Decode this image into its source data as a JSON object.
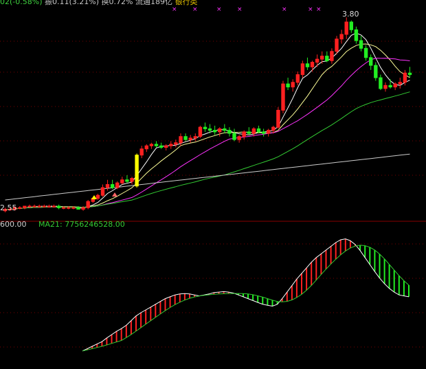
{
  "header": {
    "code_tail": "02(-0.58%)",
    "amplitude": "振0.11(3.21%)",
    "turnover": "换0.72%",
    "float_cap": "流通189亿",
    "sector": "银行类"
  },
  "indicator": {
    "value0": "600.00",
    "ma_label": "MA21: 7756246528.00"
  },
  "price_labels": {
    "high": "3.80",
    "low": "2.55"
  },
  "colors": {
    "up": "#ff2020",
    "down": "#22ee22",
    "highlight": "#ffff00",
    "ma_white": "#ffffff",
    "ma_yellow": "#ffff99",
    "ma_magenta": "#ff33ff",
    "ma_green": "#33cc33",
    "ma_gray": "#cccccc",
    "marker": "#ff33ff",
    "grid": "#7a0000"
  },
  "chart_data": {
    "type": "candlestick",
    "ohlc": [
      [
        2.55,
        2.57,
        2.54,
        2.56
      ],
      [
        2.56,
        2.57,
        2.55,
        2.56
      ],
      [
        2.56,
        2.58,
        2.55,
        2.57
      ],
      [
        2.57,
        2.58,
        2.56,
        2.57
      ],
      [
        2.57,
        2.58,
        2.56,
        2.58
      ],
      [
        2.58,
        2.59,
        2.57,
        2.58
      ],
      [
        2.58,
        2.59,
        2.57,
        2.58
      ],
      [
        2.58,
        2.59,
        2.57,
        2.58
      ],
      [
        2.58,
        2.59,
        2.57,
        2.58
      ],
      [
        2.58,
        2.59,
        2.57,
        2.58
      ],
      [
        2.58,
        2.59,
        2.57,
        2.58
      ],
      [
        2.58,
        2.59,
        2.56,
        2.57
      ],
      [
        2.57,
        2.58,
        2.56,
        2.57
      ],
      [
        2.57,
        2.58,
        2.56,
        2.57
      ],
      [
        2.57,
        2.58,
        2.56,
        2.57
      ],
      [
        2.57,
        2.58,
        2.56,
        2.56
      ],
      [
        2.56,
        2.58,
        2.55,
        2.57
      ],
      [
        2.57,
        2.62,
        2.56,
        2.61
      ],
      [
        2.61,
        2.64,
        2.6,
        2.63
      ],
      [
        2.63,
        2.66,
        2.62,
        2.65
      ],
      [
        2.65,
        2.72,
        2.64,
        2.7
      ],
      [
        2.7,
        2.75,
        2.68,
        2.72
      ],
      [
        2.72,
        2.75,
        2.69,
        2.7
      ],
      [
        2.7,
        2.74,
        2.69,
        2.73
      ],
      [
        2.73,
        2.77,
        2.72,
        2.75
      ],
      [
        2.75,
        2.78,
        2.73,
        2.74
      ],
      [
        2.74,
        2.77,
        2.72,
        2.76
      ],
      [
        2.71,
        2.92,
        2.7,
        2.91
      ],
      [
        2.91,
        2.97,
        2.89,
        2.95
      ],
      [
        2.95,
        2.98,
        2.93,
        2.97
      ],
      [
        2.97,
        2.99,
        2.95,
        2.98
      ],
      [
        2.98,
        3.0,
        2.96,
        2.97
      ],
      [
        2.97,
        2.99,
        2.95,
        2.96
      ],
      [
        2.96,
        2.98,
        2.94,
        2.97
      ],
      [
        2.97,
        3.0,
        2.95,
        2.98
      ],
      [
        2.98,
        3.01,
        2.96,
        2.99
      ],
      [
        2.99,
        3.05,
        2.97,
        3.03
      ],
      [
        3.03,
        3.05,
        3.0,
        3.01
      ],
      [
        3.01,
        3.04,
        2.99,
        3.02
      ],
      [
        3.02,
        3.05,
        3.0,
        3.03
      ],
      [
        3.03,
        3.1,
        3.02,
        3.09
      ],
      [
        3.09,
        3.12,
        3.06,
        3.08
      ],
      [
        3.08,
        3.11,
        3.05,
        3.07
      ],
      [
        3.07,
        3.1,
        3.04,
        3.06
      ],
      [
        3.06,
        3.09,
        3.03,
        3.08
      ],
      [
        3.08,
        3.11,
        3.05,
        3.07
      ],
      [
        3.07,
        3.09,
        3.03,
        3.05
      ],
      [
        3.05,
        3.08,
        3.0,
        3.01
      ],
      [
        3.01,
        3.04,
        2.99,
        3.03
      ],
      [
        3.03,
        3.07,
        3.01,
        3.06
      ],
      [
        3.06,
        3.09,
        3.04,
        3.05
      ],
      [
        3.05,
        3.09,
        3.03,
        3.08
      ],
      [
        3.08,
        3.1,
        3.05,
        3.06
      ],
      [
        3.06,
        3.08,
        3.03,
        3.05
      ],
      [
        3.05,
        3.08,
        3.03,
        3.07
      ],
      [
        3.07,
        3.1,
        3.05,
        3.09
      ],
      [
        3.09,
        3.22,
        3.08,
        3.2
      ],
      [
        3.2,
        3.39,
        3.18,
        3.37
      ],
      [
        3.37,
        3.41,
        3.33,
        3.35
      ],
      [
        3.35,
        3.4,
        3.32,
        3.38
      ],
      [
        3.38,
        3.45,
        3.36,
        3.43
      ],
      [
        3.43,
        3.52,
        3.41,
        3.5
      ],
      [
        3.5,
        3.54,
        3.46,
        3.48
      ],
      [
        3.48,
        3.52,
        3.45,
        3.51
      ],
      [
        3.51,
        3.56,
        3.48,
        3.53
      ],
      [
        3.53,
        3.58,
        3.5,
        3.55
      ],
      [
        3.55,
        3.58,
        3.51,
        3.52
      ],
      [
        3.52,
        3.6,
        3.5,
        3.58
      ],
      [
        3.58,
        3.68,
        3.56,
        3.66
      ],
      [
        3.66,
        3.72,
        3.63,
        3.69
      ],
      [
        3.69,
        3.8,
        3.66,
        3.77
      ],
      [
        3.77,
        3.78,
        3.7,
        3.72
      ],
      [
        3.72,
        3.74,
        3.63,
        3.65
      ],
      [
        3.65,
        3.68,
        3.58,
        3.6
      ],
      [
        3.6,
        3.62,
        3.52,
        3.54
      ],
      [
        3.54,
        3.56,
        3.46,
        3.49
      ],
      [
        3.49,
        3.51,
        3.39,
        3.41
      ],
      [
        3.41,
        3.43,
        3.33,
        3.34
      ],
      [
        3.34,
        3.38,
        3.32,
        3.36
      ],
      [
        3.36,
        3.4,
        3.34,
        3.35
      ],
      [
        3.35,
        3.38,
        3.33,
        3.37
      ],
      [
        3.37,
        3.41,
        3.34,
        3.38
      ],
      [
        3.38,
        3.46,
        3.36,
        3.44
      ],
      [
        3.44,
        3.48,
        3.41,
        3.43
      ]
    ],
    "volume_osc": [
      -0.6,
      -0.55,
      -0.5,
      -0.45,
      -0.4,
      -0.32,
      -0.25,
      -0.18,
      -0.12,
      -0.05,
      0.05,
      0.15,
      0.22,
      0.28,
      0.34,
      0.4,
      0.46,
      0.52,
      0.56,
      0.6,
      0.62,
      0.63,
      0.62,
      0.6,
      0.58,
      0.6,
      0.62,
      0.65,
      0.66,
      0.67,
      0.66,
      0.64,
      0.6,
      0.56,
      0.52,
      0.48,
      0.44,
      0.4,
      0.38,
      0.36,
      0.4,
      0.52,
      0.66,
      0.8,
      0.94,
      1.06,
      1.18,
      1.3,
      1.4,
      1.48,
      1.56,
      1.64,
      1.72,
      1.78,
      1.8,
      1.76,
      1.68,
      1.55,
      1.4,
      1.25,
      1.1,
      0.96,
      0.84,
      0.74,
      0.66,
      0.6,
      0.58,
      0.56
    ],
    "ylim": [
      2.5,
      3.85
    ],
    "high_label": "3.80",
    "low_label": "2.55"
  }
}
